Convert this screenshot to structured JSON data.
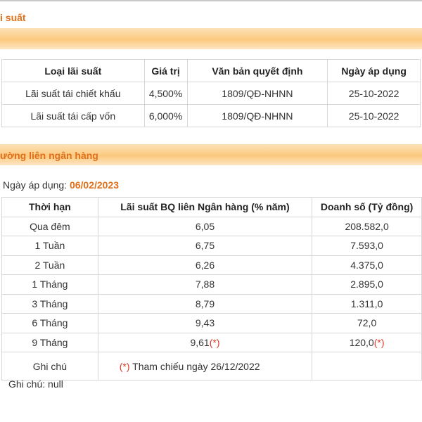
{
  "section1": {
    "title": "i suất",
    "headers": [
      "Loại lãi suất",
      "Giá trị",
      "Văn bản quyết định",
      "Ngày áp dụng"
    ],
    "rows": [
      {
        "type": "Lãi suất tái chiết khấu",
        "value": "4,500%",
        "decision": "1809/QĐ-NHNN",
        "date": "25-10-2022"
      },
      {
        "type": "Lãi suất tái cấp vốn",
        "value": "6,000%",
        "decision": "1809/QĐ-NHNN",
        "date": "25-10-2022"
      }
    ]
  },
  "section2": {
    "title": "ường liên ngân hàng",
    "applied_label": "Ngày áp dụng:",
    "applied_date": "06/02/2023",
    "headers": [
      "Thời hạn",
      "Lãi suất BQ liên Ngân hàng (% năm)",
      "Doanh số (Tỷ đồng)"
    ],
    "rows": [
      {
        "term": "Qua đêm",
        "rate": "6,05",
        "volume": "208.582,0",
        "rate_mark": "",
        "volume_mark": ""
      },
      {
        "term": "1 Tuần",
        "rate": "6,75",
        "volume": "7.593,0",
        "rate_mark": "",
        "volume_mark": ""
      },
      {
        "term": "2 Tuần",
        "rate": "6,26",
        "volume": "4.375,0",
        "rate_mark": "",
        "volume_mark": ""
      },
      {
        "term": "1 Tháng",
        "rate": "7,88",
        "volume": "2.895,0",
        "rate_mark": "",
        "volume_mark": ""
      },
      {
        "term": "3 Tháng",
        "rate": "8,79",
        "volume": "1.311,0",
        "rate_mark": "",
        "volume_mark": ""
      },
      {
        "term": "6 Tháng",
        "rate": "9,43",
        "volume": "72,0",
        "rate_mark": "",
        "volume_mark": ""
      },
      {
        "term": "9 Tháng",
        "rate": "9,61",
        "volume": "120,0",
        "rate_mark": "(*)",
        "volume_mark": "(*)"
      }
    ],
    "note_label": "Ghi chú",
    "note_mark": "(*)",
    "note_text": "Tham chiếu ngày 26/12/2022"
  },
  "footnote": "Ghi chú: null",
  "colors": {
    "accent": "#e0701a",
    "mark": "#e03a2b",
    "bar": "#fbc97e"
  }
}
